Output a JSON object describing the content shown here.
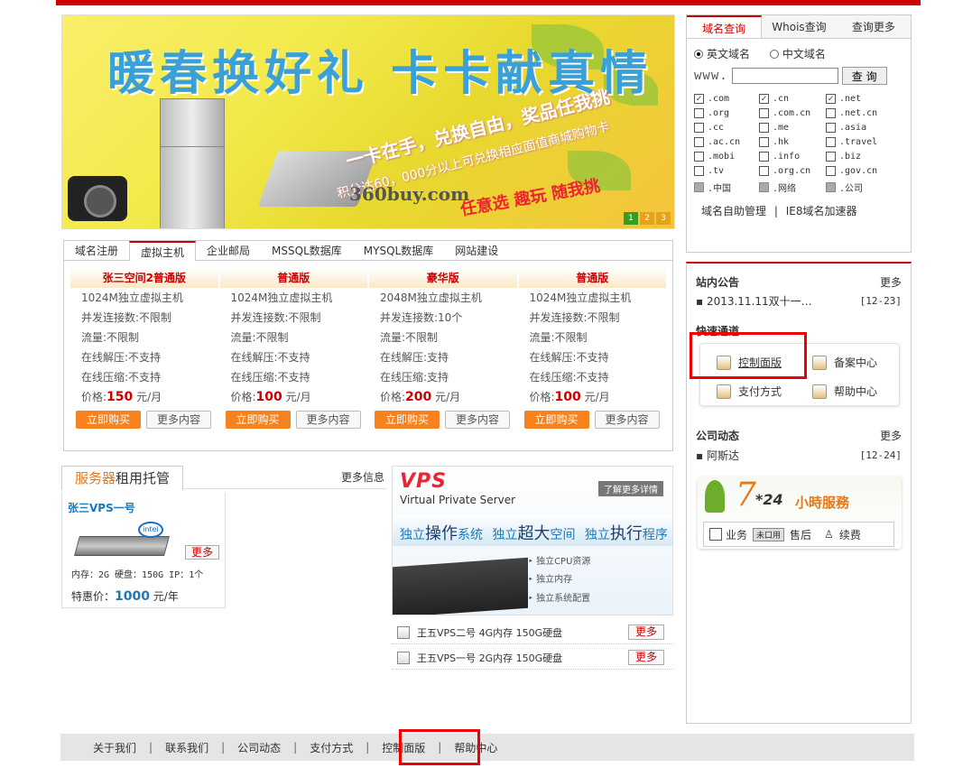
{
  "banner": {
    "title": "暖春换好礼 卡卡献真情",
    "line1": "一卡在手，兑换自由，奖品任我挑",
    "line2": "积分达60，000分以上可兑换相应面值商城购物卡",
    "logo": "360buy.com",
    "fun": "任意选 趣玩 随我挑",
    "pages": [
      "1",
      "2",
      "3"
    ]
  },
  "domain": {
    "tabs": [
      "域名查询",
      "Whois查询",
      "查询更多"
    ],
    "radio_en": "英文域名",
    "radio_cn": "中文域名",
    "www_label": "www.",
    "search_value": "",
    "search_button": "查 询",
    "exts": [
      {
        "label": ".com",
        "checked": true
      },
      {
        "label": ".cn",
        "checked": true
      },
      {
        "label": ".net",
        "checked": true
      },
      {
        "label": ".org",
        "checked": false
      },
      {
        "label": ".com.cn",
        "checked": false
      },
      {
        "label": ".net.cn",
        "checked": false
      },
      {
        "label": ".cc",
        "checked": false
      },
      {
        "label": ".me",
        "checked": false
      },
      {
        "label": ".asia",
        "checked": false
      },
      {
        "label": ".ac.cn",
        "checked": false
      },
      {
        "label": ".hk",
        "checked": false
      },
      {
        "label": ".travel",
        "checked": false
      },
      {
        "label": ".mobi",
        "checked": false
      },
      {
        "label": ".info",
        "checked": false
      },
      {
        "label": ".biz",
        "checked": false
      },
      {
        "label": ".tv",
        "checked": false
      },
      {
        "label": ".org.cn",
        "checked": false
      },
      {
        "label": ".gov.cn",
        "checked": false
      },
      {
        "label": ".中国",
        "checked": false,
        "gray": true
      },
      {
        "label": ".网络",
        "checked": false,
        "gray": true
      },
      {
        "label": ".公司",
        "checked": false,
        "gray": true
      }
    ],
    "link1": "域名自助管理",
    "link_sep": "|",
    "link2": "IE8域名加速器"
  },
  "products": {
    "tabs": [
      "域名注册",
      "虚拟主机",
      "企业邮局",
      "MSSQL数据库",
      "MYSQL数据库",
      "网站建设"
    ],
    "active_tab": 1,
    "plans": [
      {
        "name": "张三空间2普通版",
        "r1": "1024M独立虚拟主机",
        "r2": "并发连接数:不限制",
        "r3": "流量:不限制",
        "r4": "在线解压:不支持",
        "r5": "在线压缩:不支持",
        "price_label": "价格:",
        "price": "150",
        "unit": " 元/月",
        "buy": "立即购买",
        "more": "更多内容"
      },
      {
        "name": "普通版",
        "r1": "1024M独立虚拟主机",
        "r2": "并发连接数:不限制",
        "r3": "流量:不限制",
        "r4": "在线解压:不支持",
        "r5": "在线压缩:不支持",
        "price_label": "价格:",
        "price": "100",
        "unit": " 元/月",
        "buy": "立即购买",
        "more": "更多内容"
      },
      {
        "name": "豪华版",
        "r1": "2048M独立虚拟主机",
        "r2": "并发连接数:10个",
        "r3": "流量:不限制",
        "r4": "在线解压:支持",
        "r5": "在线压缩:支持",
        "price_label": "价格:",
        "price": "200",
        "unit": " 元/月",
        "buy": "立即购买",
        "more": "更多内容"
      },
      {
        "name": "普通版",
        "r1": "1024M独立虚拟主机",
        "r2": "并发连接数:不限制",
        "r3": "流量:不限制",
        "r4": "在线解压:不支持",
        "r5": "在线压缩:不支持",
        "price_label": "价格:",
        "price": "100",
        "unit": " 元/月",
        "buy": "立即购买",
        "more": "更多内容"
      }
    ]
  },
  "server": {
    "title_em": "服务器",
    "title_rest": "租用托管",
    "more": "更多信息",
    "name": "张三VPS一号",
    "intel": "intel",
    "more_btn": "更多",
    "spec": "内存：2G 硬盘：150G IP：1个",
    "price_label": "特惠价：",
    "price": "1000",
    "unit": " 元/年"
  },
  "vps": {
    "logo": "VPS",
    "subtitle": "Virtual Private Server",
    "detail": "了解更多详情",
    "s1a": "独立",
    "s1b": "操作",
    "s1c": "系统",
    "s2a": "独立",
    "s2b": "超大",
    "s2c": "空间",
    "s3a": "独立",
    "s3b": "执行",
    "s3c": "程序",
    "features": [
      "独立CPU资源",
      "独立内存",
      "独立系统配置"
    ],
    "items": [
      {
        "name": "王五VPS二号 4G内存 150G硬盘",
        "more": "更多"
      },
      {
        "name": "王五VPS一号 2G内存 150G硬盘",
        "more": "更多"
      }
    ]
  },
  "right": {
    "notice_title": "站内公告",
    "notice_more": "更多",
    "notice_item": "▪ 2013.11.11双十一…",
    "notice_date": "[12-23]",
    "quick_title": "快速通道",
    "quick": [
      "控制面版",
      "备案中心",
      "支付方式",
      "帮助中心"
    ],
    "news_title": "公司动态",
    "news_more": "更多",
    "news_item": "▪ 阿斯达",
    "news_date": "[12-24]",
    "hours_7": "7",
    "hours_24": "*24",
    "hours_txt": "小時服務",
    "opt1": "业务",
    "opt_noq": "未口用",
    "opt2": "售后",
    "opt3": "续费"
  },
  "footer": {
    "links": [
      "关于我们",
      "联系我们",
      "公司动态",
      "支付方式",
      "控制面版",
      "帮助中心"
    ],
    "sep": "|"
  },
  "colors": {
    "accent": "#cc0000",
    "orange": "#f5821f",
    "blue": "#1a7ab8"
  }
}
